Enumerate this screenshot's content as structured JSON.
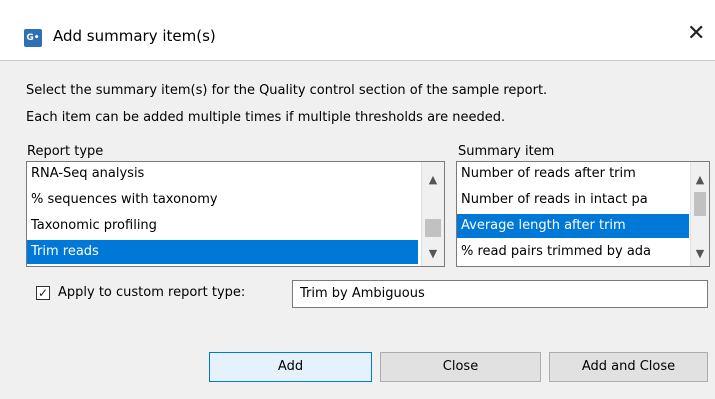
{
  "window": {
    "title": "Add summary item(s)",
    "app_icon_text": "G•",
    "close_glyph": "✕"
  },
  "instructions": {
    "line1": "Select the summary item(s) for the Quality control section of the sample report.",
    "line2": "Each item can be added multiple times if multiple thresholds are needed."
  },
  "report_type": {
    "header": "Report type",
    "items": [
      {
        "label": "RNA-Seq analysis",
        "selected": false
      },
      {
        "label": "% sequences with taxonomy",
        "selected": false
      },
      {
        "label": "Taxonomic profiling",
        "selected": false
      },
      {
        "label": "Trim reads",
        "selected": true
      }
    ]
  },
  "summary_item": {
    "header": "Summary item",
    "items": [
      {
        "label": "Number of reads after trim",
        "selected": false
      },
      {
        "label": "Number of reads in intact pa",
        "selected": false
      },
      {
        "label": "Average length after trim",
        "selected": true
      },
      {
        "label": "% read pairs trimmed by ada",
        "selected": false
      }
    ]
  },
  "custom": {
    "checked": true,
    "check_glyph": "✓",
    "label": "Apply to custom report type:",
    "value": "Trim by Ambiguous"
  },
  "buttons": {
    "add": "Add",
    "close": "Close",
    "add_and_close": "Add and Close"
  },
  "icons": {
    "scroll_up": "▲",
    "scroll_down": "▼"
  },
  "colors": {
    "selection": "#0078d7",
    "primary_button_border": "#0078d7"
  }
}
